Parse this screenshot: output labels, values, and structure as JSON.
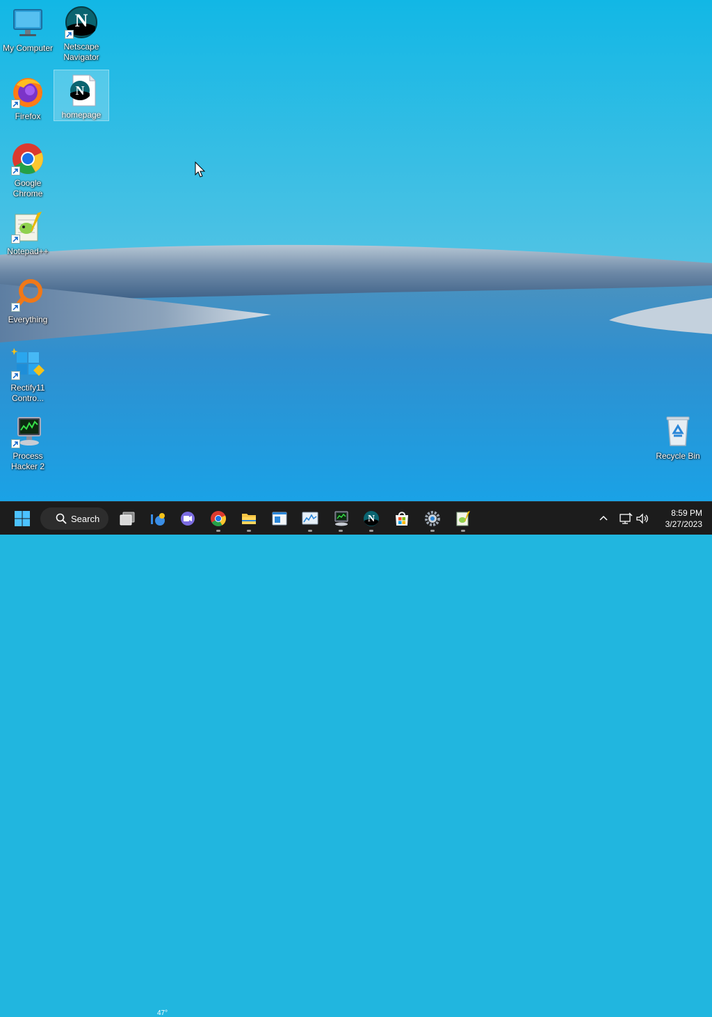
{
  "desktop": {
    "icons": [
      {
        "label": "My Computer",
        "icon": "monitor-icon"
      },
      {
        "label": "Netscape\nNavigator",
        "icon": "netscape-icon"
      },
      {
        "label": "Firefox",
        "icon": "firefox-icon"
      },
      {
        "label": "homepage",
        "icon": "netscape-document-icon"
      },
      {
        "label": "Google\nChrome",
        "icon": "chrome-icon"
      },
      {
        "label": "Notepad++",
        "icon": "notepad-plus-plus-icon"
      },
      {
        "label": "Everything",
        "icon": "magnifier-icon"
      },
      {
        "label": "Rectify11\nContro...",
        "icon": "rectify11-icon"
      },
      {
        "label": "Process\nHacker 2",
        "icon": "process-hacker-icon"
      },
      {
        "label": "Recycle Bin",
        "icon": "recycle-bin-icon"
      }
    ]
  },
  "taskbar": {
    "search_label": "Search",
    "weather_temp": "47°",
    "pinned": [
      "start-icon",
      "search-icon",
      "task-view-icon",
      "widgets-icon",
      "chat-icon",
      "chrome-icon",
      "file-explorer-icon",
      "notepad-icon",
      "resource-monitor-icon",
      "process-hacker-icon",
      "netscape-icon",
      "store-icon",
      "settings-icon",
      "notepad-plus-plus-icon"
    ],
    "tray": {
      "chevron": "chevron-up-icon",
      "network": "network-icon",
      "volume": "volume-icon"
    },
    "clock": {
      "time": "8:59 PM",
      "date": "3/27/2023"
    }
  },
  "colors": {
    "taskbar_bg": "#1c1c1c",
    "sky_top": "#13b8e6",
    "water": "#2b95d3",
    "accent": "#0078d4"
  }
}
